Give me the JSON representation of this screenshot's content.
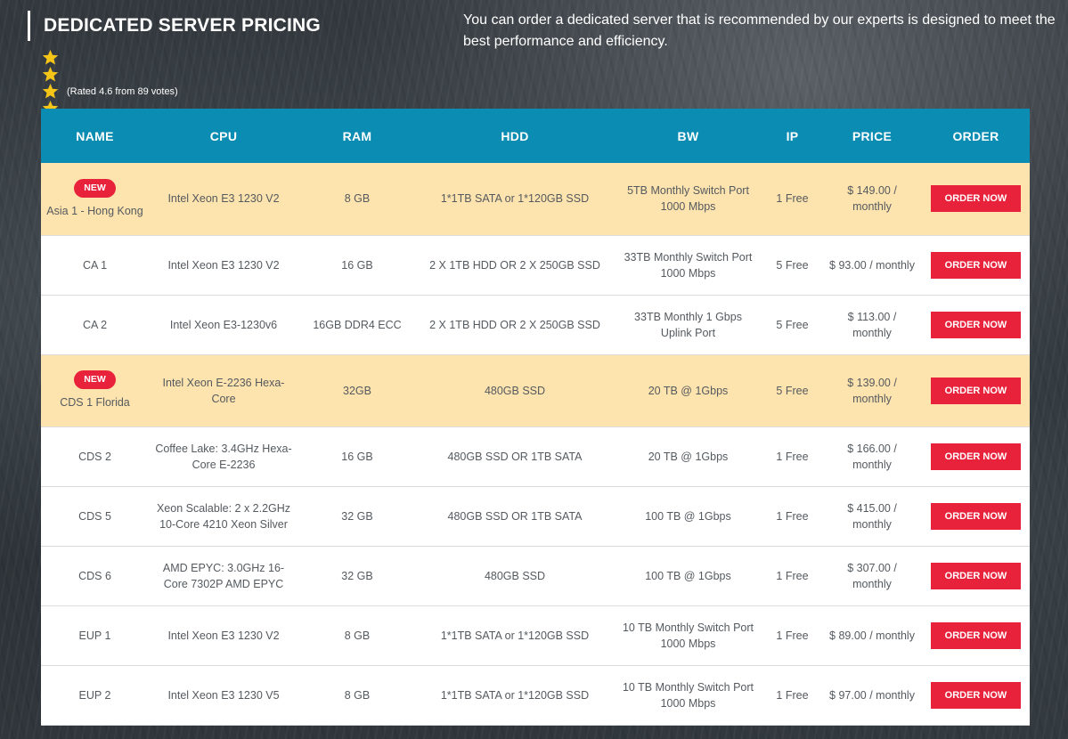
{
  "header": {
    "title": "DEDICATED SERVER PRICING",
    "rating": {
      "stars": 4.6,
      "max": 5,
      "text": "(Rated 4.6 from 89 votes)"
    },
    "description": "You can order a dedicated server that is recommended by our experts is designed to meet the best performance and efficiency."
  },
  "colors": {
    "header_bg": "#0a8cb3",
    "featured_row": "#fde3ae",
    "accent_red": "#e8223b",
    "star_yellow": "#f5c518"
  },
  "table": {
    "columns": [
      "NAME",
      "CPU",
      "RAM",
      "HDD",
      "BW",
      "IP",
      "PRICE",
      "ORDER"
    ],
    "rows": [
      {
        "featured": true,
        "badge": "NEW",
        "name": "Asia 1 - Hong Kong",
        "cpu": "Intel Xeon E3 1230 V2",
        "ram": "8 GB",
        "hdd": "1*1TB SATA or 1*120GB SSD",
        "bw": "5TB Monthly Switch Port 1000 Mbps",
        "ip": "1 Free",
        "price": "$ 149.00 / monthly",
        "order": "ORDER NOW"
      },
      {
        "featured": false,
        "badge": "",
        "name": "CA 1",
        "cpu": "Intel Xeon E3 1230 V2",
        "ram": "16 GB",
        "hdd": "2 X 1TB HDD OR 2 X 250GB SSD",
        "bw": "33TB Monthly Switch Port 1000 Mbps",
        "ip": "5 Free",
        "price": "$ 93.00 / monthly",
        "order": "ORDER NOW"
      },
      {
        "featured": false,
        "badge": "",
        "name": "CA 2",
        "cpu": "Intel Xeon E3-1230v6",
        "ram": "16GB DDR4 ECC",
        "hdd": "2 X 1TB HDD OR 2 X 250GB SSD",
        "bw": "33TB Monthly 1 Gbps Uplink Port",
        "ip": "5 Free",
        "price": "$ 113.00 / monthly",
        "order": "ORDER NOW"
      },
      {
        "featured": true,
        "badge": "NEW",
        "name": "CDS 1 Florida",
        "cpu": "Intel Xeon E-2236 Hexa-Core",
        "ram": "32GB",
        "hdd": "480GB SSD",
        "bw": "20 TB @ 1Gbps",
        "ip": "5 Free",
        "price": "$ 139.00 / monthly",
        "order": "ORDER NOW"
      },
      {
        "featured": false,
        "badge": "",
        "name": "CDS 2",
        "cpu": "Coffee Lake: 3.4GHz Hexa-Core E-2236",
        "ram": "16 GB",
        "hdd": "480GB SSD OR 1TB SATA",
        "bw": "20 TB @ 1Gbps",
        "ip": "1 Free",
        "price": "$ 166.00 / monthly",
        "order": "ORDER NOW"
      },
      {
        "featured": false,
        "badge": "",
        "name": "CDS 5",
        "cpu": "Xeon Scalable: 2 x 2.2GHz 10-Core 4210 Xeon Silver",
        "ram": "32 GB",
        "hdd": "480GB SSD OR 1TB SATA",
        "bw": "100 TB @ 1Gbps",
        "ip": "1 Free",
        "price": "$ 415.00 / monthly",
        "order": "ORDER NOW"
      },
      {
        "featured": false,
        "badge": "",
        "name": "CDS 6",
        "cpu": "AMD EPYC: 3.0GHz 16-Core 7302P AMD EPYC",
        "ram": "32 GB",
        "hdd": "480GB SSD",
        "bw": "100 TB @ 1Gbps",
        "ip": "1 Free",
        "price": "$ 307.00 / monthly",
        "order": "ORDER NOW"
      },
      {
        "featured": false,
        "badge": "",
        "name": "EUP 1",
        "cpu": "Intel Xeon E3 1230 V2",
        "ram": "8 GB",
        "hdd": "1*1TB SATA or 1*120GB SSD",
        "bw": "10 TB Monthly Switch Port 1000 Mbps",
        "ip": "1 Free",
        "price": "$ 89.00 / monthly",
        "order": "ORDER NOW"
      },
      {
        "featured": false,
        "badge": "",
        "name": "EUP 2",
        "cpu": "Intel Xeon E3 1230 V5",
        "ram": "8 GB",
        "hdd": "1*1TB SATA or 1*120GB SSD",
        "bw": "10 TB Monthly Switch Port 1000 Mbps",
        "ip": "1 Free",
        "price": "$ 97.00 / monthly",
        "order": "ORDER NOW"
      }
    ]
  }
}
